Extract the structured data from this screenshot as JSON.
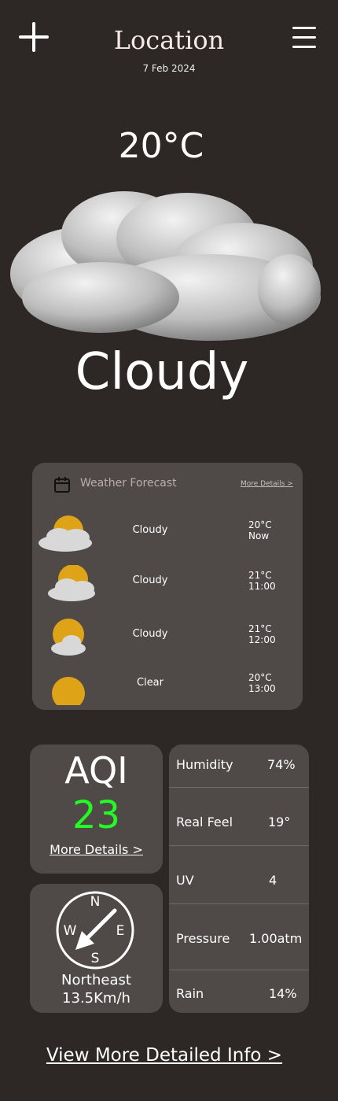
{
  "header": {
    "title": "Location",
    "date": "7 Feb 2024"
  },
  "current": {
    "temperature": "20°C",
    "condition": "Cloudy"
  },
  "forecast": {
    "title": "Weather Forecast",
    "more_link": "More Details >",
    "rows": [
      {
        "condition": "Cloudy",
        "temp": "20°C",
        "time": "Now",
        "icon": "sun-behind-cloud-icon"
      },
      {
        "condition": "Cloudy",
        "temp": "21°C",
        "time": "11:00",
        "icon": "sun-behind-cloud-icon"
      },
      {
        "condition": "Cloudy",
        "temp": "21°C",
        "time": "12:00",
        "icon": "sun-behind-small-cloud-icon"
      },
      {
        "condition": "Clear",
        "temp": "20°C",
        "time": "13:00",
        "icon": "sun-icon"
      }
    ]
  },
  "aqi": {
    "label": "AQI",
    "value": "23",
    "more_link": "More Details >"
  },
  "wind": {
    "direction": "Northeast",
    "speed": "13.5Km/h",
    "compass": {
      "n": "N",
      "e": "E",
      "s": "S",
      "w": "W"
    }
  },
  "stats": [
    {
      "label": "Humidity",
      "value": "74%"
    },
    {
      "label": "Real Feel",
      "value": "19°"
    },
    {
      "label": "UV",
      "value": "4"
    },
    {
      "label": "Pressure",
      "value": "1.00atm"
    },
    {
      "label": "Rain",
      "value": "14%"
    }
  ],
  "footer": {
    "link": "View More Detailed Info >"
  },
  "colors": {
    "background": "#2d2826",
    "card": "#4f4a48",
    "aqi_value": "#22ff22",
    "sun": "#dea316"
  }
}
